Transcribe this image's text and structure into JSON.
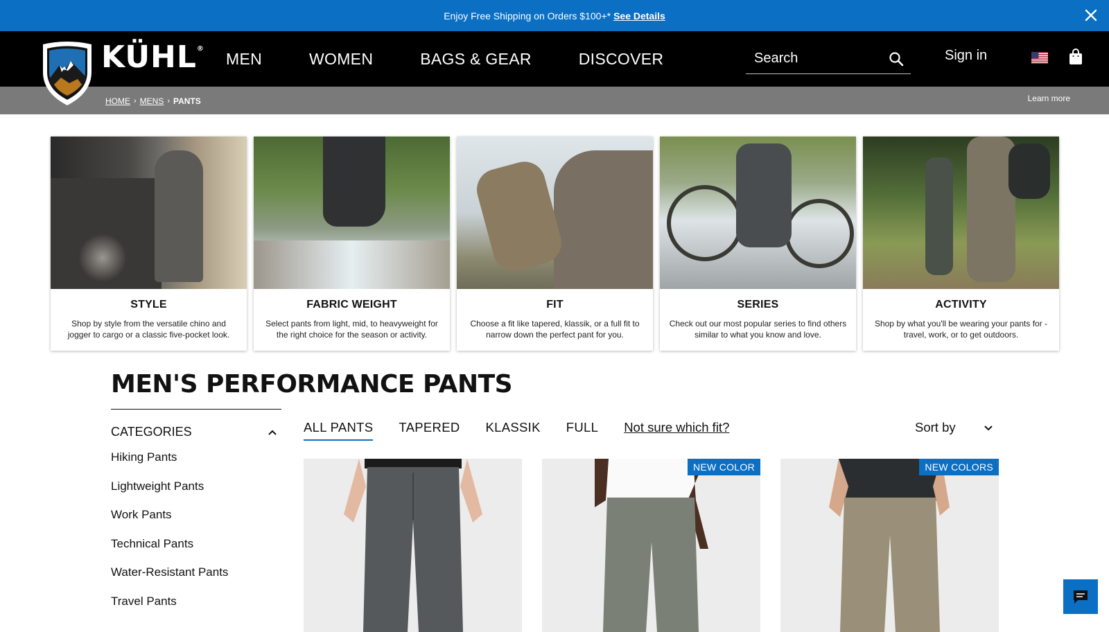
{
  "announcement": {
    "text": "Enjoy Free Shipping on Orders $100+*",
    "link": "See Details",
    "close_icon": "close-icon"
  },
  "header": {
    "brand": "KÜHL",
    "brand_mark": "®",
    "nav": [
      "MEN",
      "WOMEN",
      "BAGS & GEAR",
      "DISCOVER"
    ],
    "search_placeholder": "Search",
    "sign_in": "Sign in",
    "icons": {
      "search": "search-icon",
      "flag": "us-flag-icon",
      "bag": "shopping-bag-icon"
    }
  },
  "breadcrumb": {
    "items": [
      "HOME",
      "MENS"
    ],
    "current": "PANTS",
    "separator": "›",
    "learn_more": "Learn more"
  },
  "category_cards": [
    {
      "title": "STYLE",
      "description": "Shop by style from the versatile chino and jogger to cargo or a classic five-pocket look."
    },
    {
      "title": "FABRIC WEIGHT",
      "description": "Select pants from light, mid, to heavyweight for the right choice for the season or activity."
    },
    {
      "title": "FIT",
      "description": "Choose a fit like tapered, klassik, or a full fit to narrow down the perfect pant for you."
    },
    {
      "title": "SERIES",
      "description": "Check out our most popular series to find others similar to what you know and love."
    },
    {
      "title": "ACTIVITY",
      "description": "Shop by what you'll be wearing your pants for - travel, work, or to get outdoors."
    }
  ],
  "page_title": "MEN'S PERFORMANCE PANTS",
  "sidebar": {
    "heading": "CATEGORIES",
    "items": [
      "Hiking Pants",
      "Lightweight Pants",
      "Work Pants",
      "Technical Pants",
      "Water-Resistant Pants",
      "Travel Pants"
    ]
  },
  "fit_tabs": {
    "tabs": [
      "ALL PANTS",
      "TAPERED",
      "KLASSIK",
      "FULL"
    ],
    "active": "ALL PANTS",
    "help_link": "Not sure which fit?",
    "sort_label": "Sort by"
  },
  "products": [
    {
      "badge": ""
    },
    {
      "badge": "NEW COLOR"
    },
    {
      "badge": "NEW COLORS"
    }
  ],
  "colors": {
    "accent": "#0b6fc4",
    "header_bg": "#000000",
    "breadcrumb_bg": "#7a7a7a"
  }
}
